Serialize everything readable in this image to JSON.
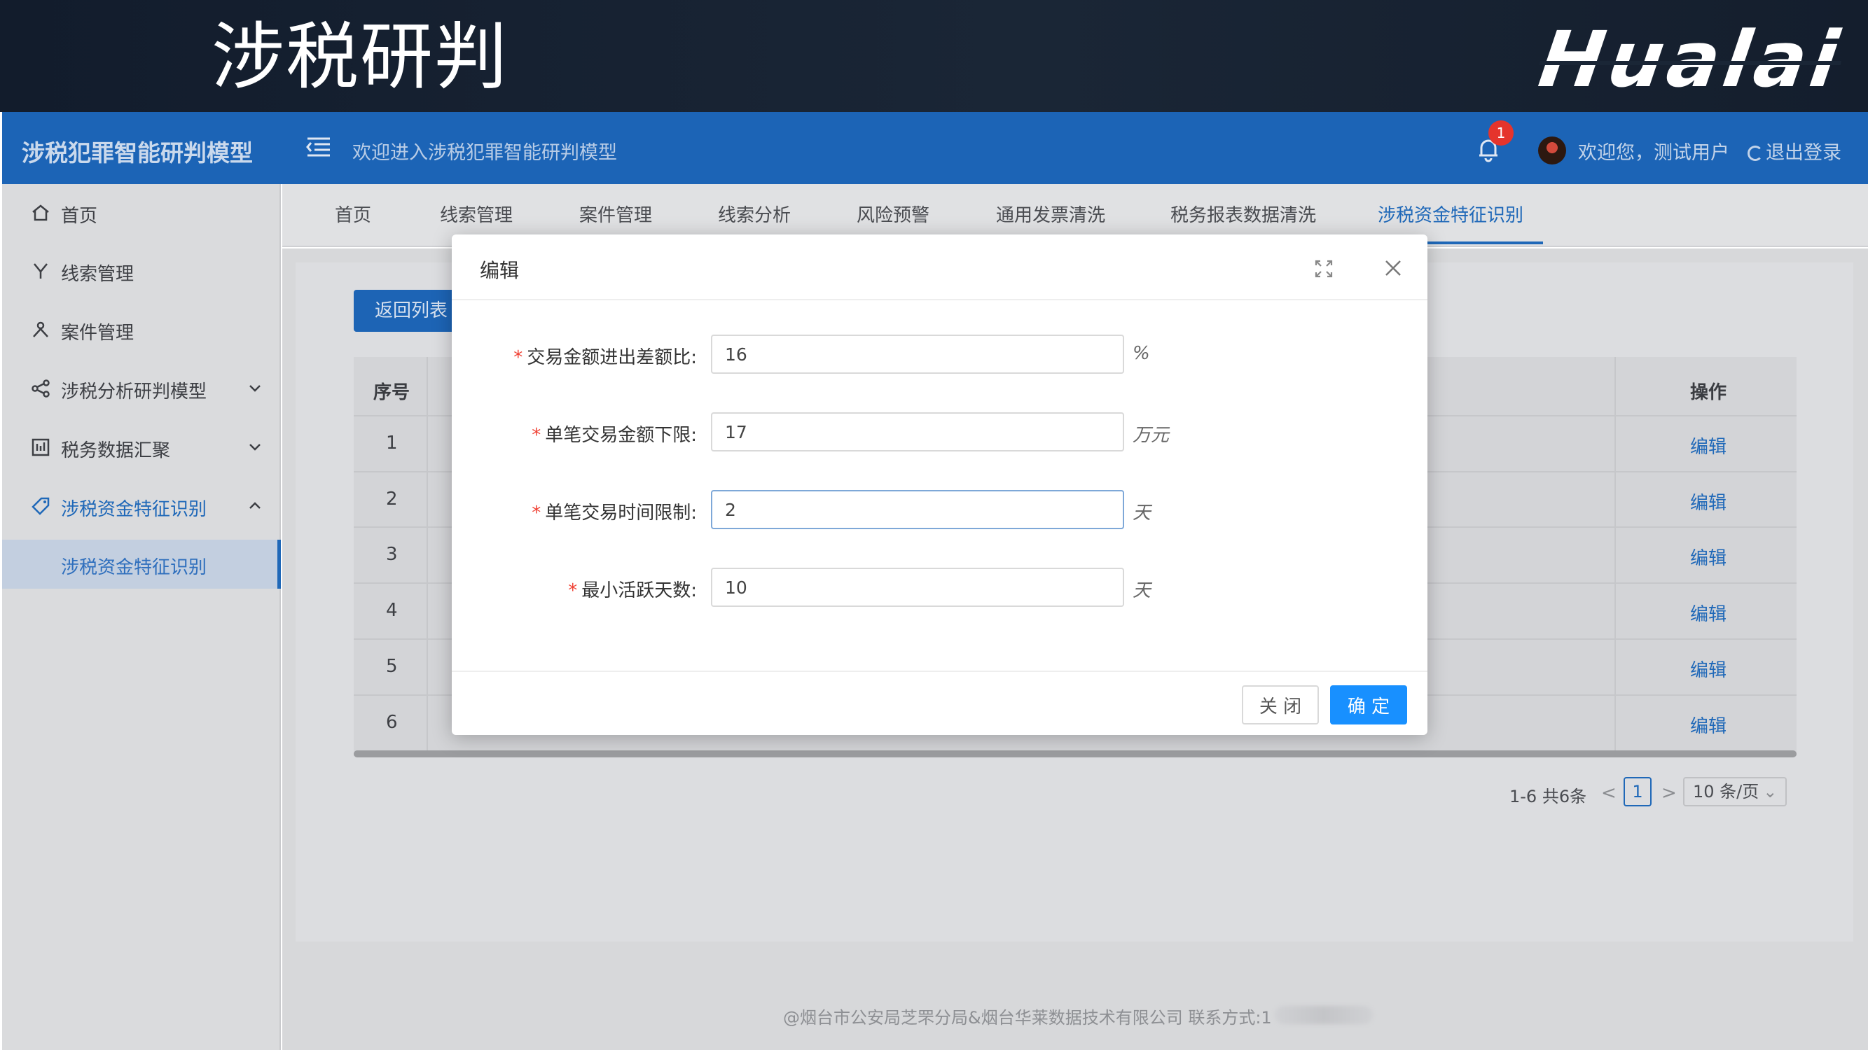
{
  "banner": {
    "title": "涉税研判",
    "brand": "Hualai"
  },
  "header": {
    "app_name": "涉税犯罪智能研判模型",
    "welcome": "欢迎进入涉税犯罪智能研判模型",
    "notification_count": "1",
    "user_greeting": "欢迎您，测试用户",
    "logout": "退出登录"
  },
  "sidebar": {
    "items": [
      {
        "label": "首页",
        "icon": "home-icon"
      },
      {
        "label": "线索管理",
        "icon": "funnel-icon"
      },
      {
        "label": "案件管理",
        "icon": "people-icon"
      },
      {
        "label": "涉税分析研判模型",
        "icon": "share-icon"
      },
      {
        "label": "税务数据汇聚",
        "icon": "chart-icon"
      },
      {
        "label": "涉税资金特征识别",
        "icon": "tag-icon"
      }
    ],
    "sub_item": "涉税资金特征识别"
  },
  "tabs": [
    "首页",
    "线索管理",
    "案件管理",
    "线索分析",
    "风险预警",
    "通用发票清洗",
    "税务报表数据清洗",
    "涉税资金特征识别"
  ],
  "content": {
    "back_button": "返回列表",
    "table": {
      "headers": {
        "index": "序号",
        "action": "操作"
      },
      "rows": [
        {
          "index": "1",
          "action": "编辑"
        },
        {
          "index": "2",
          "action": "编辑"
        },
        {
          "index": "3",
          "action": "编辑"
        },
        {
          "index": "4",
          "action": "编辑"
        },
        {
          "index": "5",
          "action": "编辑"
        },
        {
          "index": "6",
          "action": "编辑"
        }
      ]
    },
    "pagination": {
      "summary": "1-6 共6条",
      "prev": "<",
      "current": "1",
      "next": ">",
      "page_size": "10 条/页"
    }
  },
  "footer": "@烟台市公安局芝罘分局&烟台华莱数据技术有限公司 联系方式:1",
  "modal": {
    "title": "编辑",
    "fields": [
      {
        "label": "交易金额进出差额比:",
        "value": "16",
        "unit": "%"
      },
      {
        "label": "单笔交易金额下限:",
        "value": "17",
        "unit": "万元"
      },
      {
        "label": "单笔交易时间限制:",
        "value": "2",
        "unit": "天"
      },
      {
        "label": "最小活跃天数:",
        "value": "10",
        "unit": "天"
      }
    ],
    "close_button": "关 闭",
    "ok_button": "确 定"
  },
  "colors": {
    "primary": "#1c64b6",
    "button": "#1890ff",
    "required": "#f04134"
  }
}
